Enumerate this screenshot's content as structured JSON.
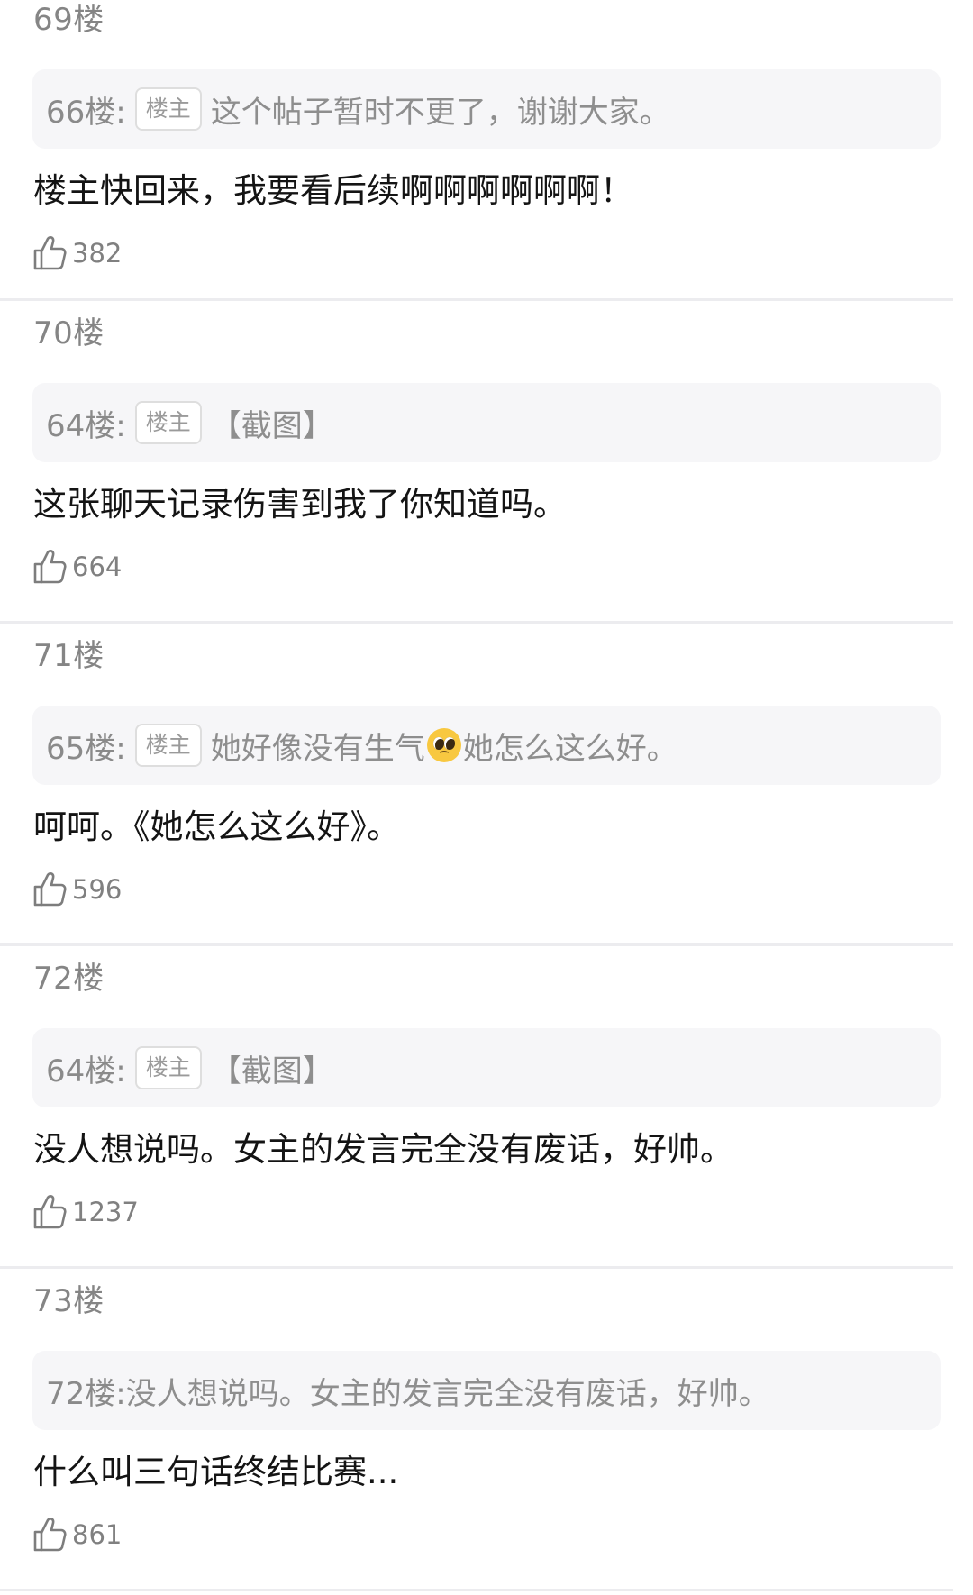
{
  "posts": [
    {
      "floor": "69楼",
      "quote_ref": "66楼:",
      "is_op": true,
      "op_badge": "楼主",
      "quote_text_before": "这个帖子暂时不更了，谢谢大家。",
      "quote_emoji": "",
      "quote_text_after": "",
      "comment": "楼主快回来，我要看后续啊啊啊啊啊啊！",
      "likes": "382"
    },
    {
      "floor": "70楼",
      "quote_ref": "64楼:",
      "is_op": true,
      "op_badge": "楼主",
      "quote_text_before": "【截图】",
      "quote_emoji": "",
      "quote_text_after": "",
      "comment": "这张聊天记录伤害到我了你知道吗。",
      "likes": "664"
    },
    {
      "floor": "71楼",
      "quote_ref": "65楼:",
      "is_op": true,
      "op_badge": "楼主",
      "quote_text_before": "她好像没有生气",
      "quote_emoji": "pleading-face-emoji",
      "quote_text_after": "她怎么这么好。",
      "comment": "呵呵。《她怎么这么好》。",
      "likes": "596"
    },
    {
      "floor": "72楼",
      "quote_ref": "64楼:",
      "is_op": true,
      "op_badge": "楼主",
      "quote_text_before": "【截图】",
      "quote_emoji": "",
      "quote_text_after": "",
      "comment": "没人想说吗。女主的发言完全没有废话，好帅。",
      "likes": "1237"
    },
    {
      "floor": "73楼",
      "quote_ref": "72楼:",
      "is_op": false,
      "op_badge": "",
      "quote_text_before": "没人想说吗。女主的发言完全没有废话，好帅。",
      "quote_emoji": "",
      "quote_text_after": "",
      "comment": "什么叫三句话终结比赛...",
      "likes": "861"
    }
  ],
  "icons": {
    "like": "thumbs-up-icon"
  },
  "colors": {
    "background": "#ffffff",
    "quote_background": "#f6f6f8",
    "divider": "#ececef",
    "muted_text": "#858585",
    "body_text": "#141414"
  }
}
